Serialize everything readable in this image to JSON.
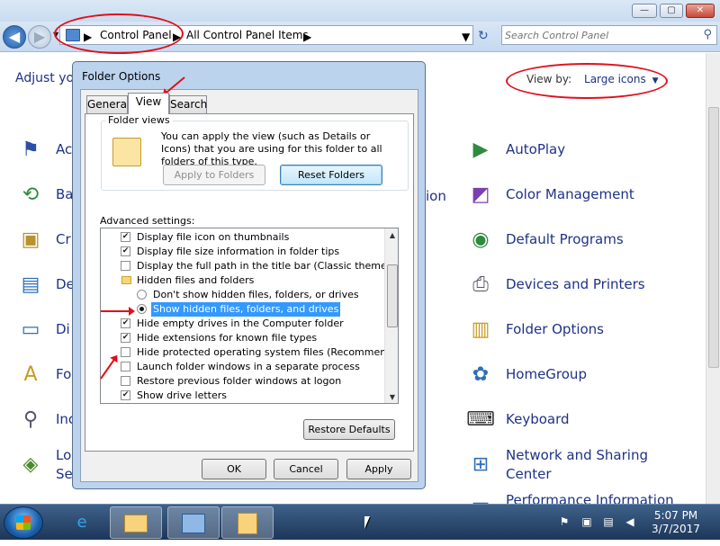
{
  "window": {
    "minimize": "—",
    "maximize": "▢",
    "close": "✕"
  },
  "address": {
    "crumbs": [
      "Control Panel",
      "All Control Panel Items"
    ],
    "refresh": "↻"
  },
  "search": {
    "placeholder": "Search Control Panel"
  },
  "content": {
    "adjust_title": "Adjust yo",
    "view_by_label": "View by:",
    "view_by_value": "Large icons",
    "left_items": [
      {
        "label": "Ac",
        "icon": "action-center-flag-icon"
      },
      {
        "label": "Ba",
        "icon": "backup-restore-icon"
      },
      {
        "label": "Cr",
        "icon": "credential-manager-icon"
      },
      {
        "label": "De",
        "icon": "desktop-gadgets-icon"
      },
      {
        "label": "Di",
        "icon": "display-icon"
      },
      {
        "label": "Fo",
        "icon": "fonts-icon"
      },
      {
        "label": "Inc",
        "icon": "indexing-options-icon"
      },
      {
        "label": "Lo\nSe",
        "icon": "location-sensors-icon"
      }
    ],
    "mid_fragment": "ion",
    "right_items": [
      {
        "label": "AutoPlay",
        "icon": "autoplay-icon"
      },
      {
        "label": "Color Management",
        "icon": "color-management-icon"
      },
      {
        "label": "Default Programs",
        "icon": "default-programs-icon"
      },
      {
        "label": "Devices and Printers",
        "icon": "devices-printers-icon"
      },
      {
        "label": "Folder Options",
        "icon": "folder-options-icon"
      },
      {
        "label": "HomeGroup",
        "icon": "homegroup-icon"
      },
      {
        "label": "Keyboard",
        "icon": "keyboard-icon"
      },
      {
        "label": "Network and Sharing Center",
        "icon": "network-sharing-icon"
      },
      {
        "label": "Performance Information",
        "icon": "performance-icon"
      }
    ]
  },
  "dialog": {
    "title": "Folder Options",
    "tabs": [
      "General",
      "View",
      "Search"
    ],
    "folder_views": {
      "legend": "Folder views",
      "description": "You can apply the view (such as Details or Icons) that you are using for this folder to all folders of this type.",
      "apply_button": "Apply to Folders",
      "reset_button": "Reset Folders"
    },
    "advanced_label": "Advanced settings:",
    "advanced_items": [
      {
        "type": "checkbox",
        "checked": true,
        "label": "Display file icon on thumbnails"
      },
      {
        "type": "checkbox",
        "checked": true,
        "label": "Display file size information in folder tips"
      },
      {
        "type": "checkbox",
        "checked": false,
        "label": "Display the full path in the title bar (Classic theme only)"
      },
      {
        "type": "folder",
        "label": "Hidden files and folders"
      },
      {
        "type": "radio",
        "checked": false,
        "label": "Don't show hidden files, folders, or drives"
      },
      {
        "type": "radio",
        "checked": true,
        "label": "Show hidden files, folders, and drives"
      },
      {
        "type": "checkbox",
        "checked": true,
        "label": "Hide empty drives in the Computer folder"
      },
      {
        "type": "checkbox",
        "checked": true,
        "label": "Hide extensions for known file types"
      },
      {
        "type": "checkbox",
        "checked": false,
        "label": "Hide protected operating system files (Recommended)"
      },
      {
        "type": "checkbox",
        "checked": false,
        "label": "Launch folder windows in a separate process"
      },
      {
        "type": "checkbox",
        "checked": false,
        "label": "Restore previous folder windows at logon"
      },
      {
        "type": "checkbox",
        "checked": true,
        "label": "Show drive letters"
      }
    ],
    "restore_defaults": "Restore Defaults",
    "ok": "OK",
    "cancel": "Cancel",
    "apply": "Apply"
  },
  "taskbar": {
    "clock_time": "5:07 PM",
    "clock_date": "3/7/2017"
  },
  "colors": {
    "annotation": "#e0101a",
    "link_blue": "#1e3287",
    "selection": "#3399ff"
  }
}
